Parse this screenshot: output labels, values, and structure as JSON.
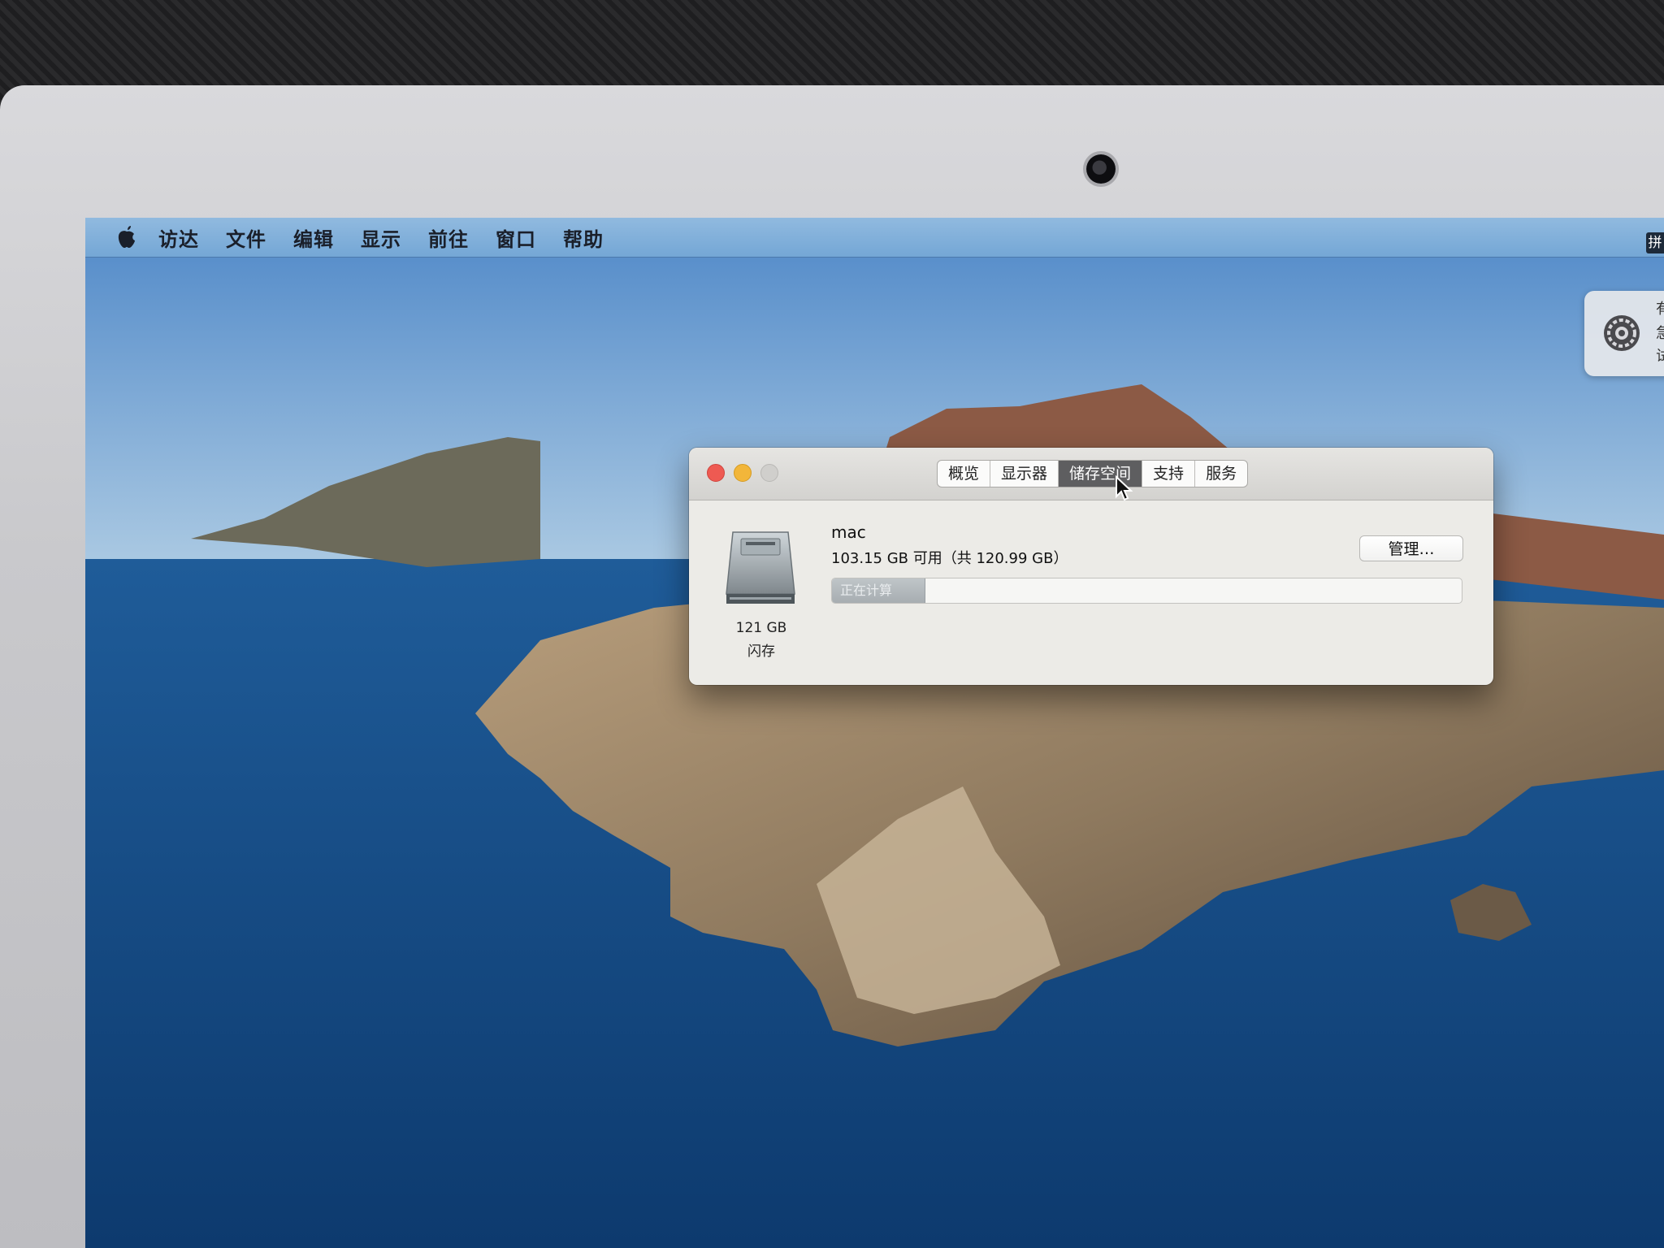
{
  "menubar": {
    "items": [
      "访达",
      "文件",
      "编辑",
      "显示",
      "前往",
      "窗口",
      "帮助"
    ],
    "input_method": "拼"
  },
  "notification": {
    "lines": [
      "有",
      "急",
      "试"
    ]
  },
  "about_window": {
    "tabs": [
      {
        "label": "概览",
        "active": false
      },
      {
        "label": "显示器",
        "active": false
      },
      {
        "label": "储存空间",
        "active": true
      },
      {
        "label": "支持",
        "active": false
      },
      {
        "label": "服务",
        "active": false
      }
    ],
    "disk": {
      "size": "121 GB",
      "type": "闪存"
    },
    "volume": {
      "name": "mac",
      "info": "103.15 GB 可用（共 120.99 GB）",
      "bar_label": "正在计算",
      "bar_fill_fraction": 0.147
    },
    "manage_label": "管理…"
  },
  "colors": {
    "close": "#ee5a52",
    "minimize": "#f2b63a",
    "zoom_inactive": "#d0cfcc",
    "active_tab": "#5e5e60"
  }
}
